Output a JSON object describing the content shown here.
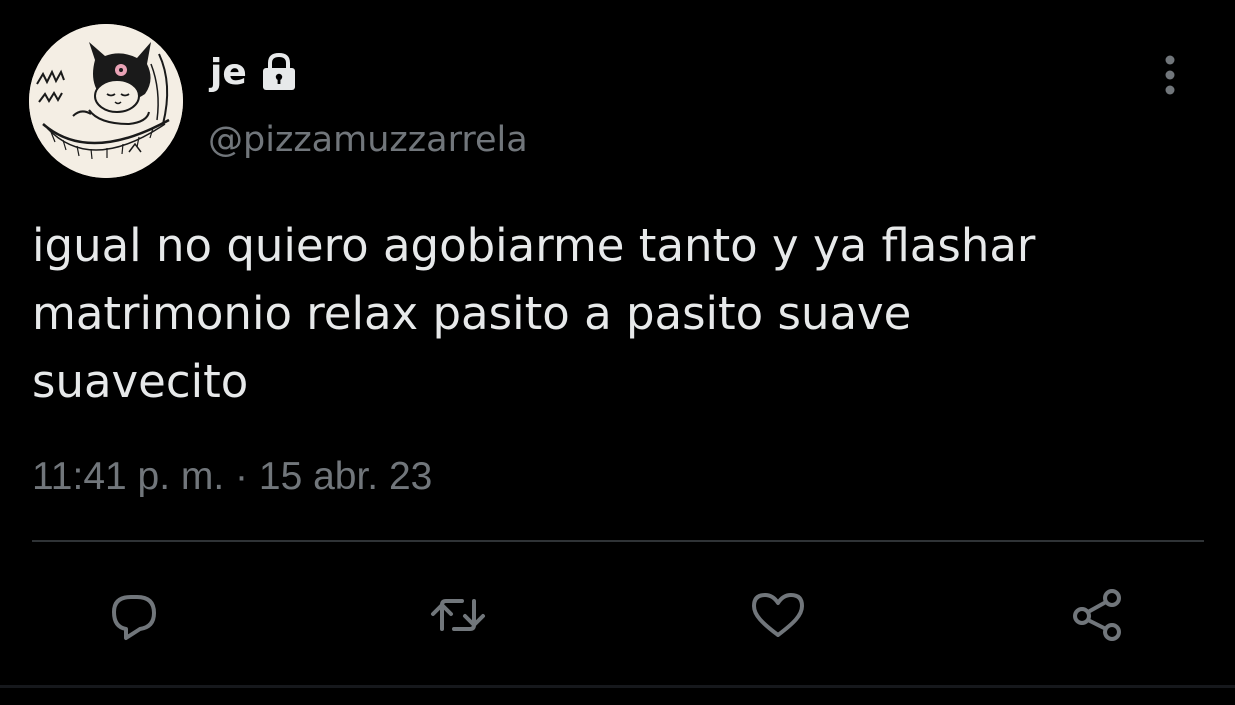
{
  "tweet": {
    "author": {
      "display_name": "je",
      "handle": "@pizzamuzzarrela",
      "protected_icon": "lock-icon",
      "avatar_icon": "kuromi-avatar"
    },
    "text": "igual no quiero agobiarme tanto y ya flashar\nmatrimonio relax pasito a pasito suave\nsuavecito",
    "timestamp": "11:41 p. m. · 15 abr. 23",
    "menu_icon": "more-vertical-icon",
    "actions": [
      {
        "name": "reply",
        "icon": "reply-icon"
      },
      {
        "name": "retweet",
        "icon": "retweet-icon"
      },
      {
        "name": "like",
        "icon": "heart-icon"
      },
      {
        "name": "share",
        "icon": "share-icon"
      }
    ]
  },
  "colors": {
    "background": "#000000",
    "primary_text": "#e7e9ea",
    "secondary_text": "#71767b",
    "divider": "#2f3336",
    "avatar_bg": "#f4eee4"
  }
}
